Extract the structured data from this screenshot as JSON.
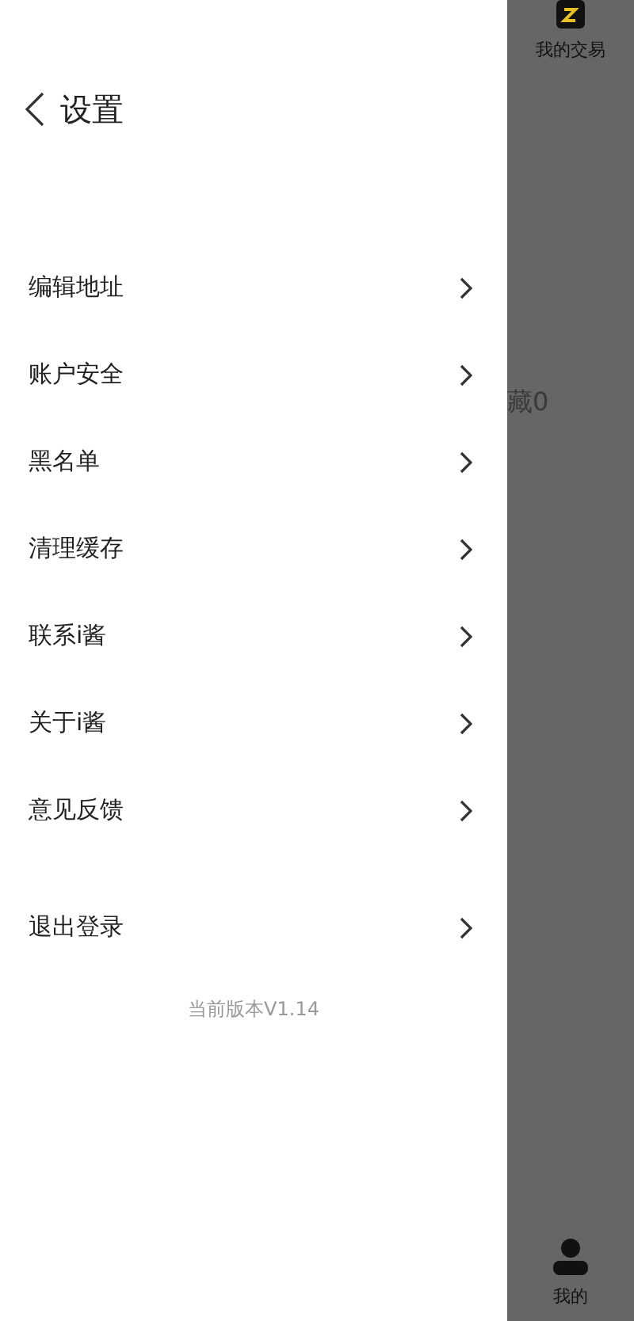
{
  "drawer": {
    "title": "设置",
    "items": [
      {
        "label": "编辑地址"
      },
      {
        "label": "账户安全"
      },
      {
        "label": "黑名单"
      },
      {
        "label": "清理缓存"
      },
      {
        "label": "联系i酱"
      },
      {
        "label": "关于i酱"
      },
      {
        "label": "意见反馈"
      }
    ],
    "logout": {
      "label": "退出登录"
    },
    "version": "当前版本V1.14"
  },
  "background": {
    "top_tab": "我的交易",
    "favorites": "藏0",
    "bottom_tab": "我的"
  }
}
